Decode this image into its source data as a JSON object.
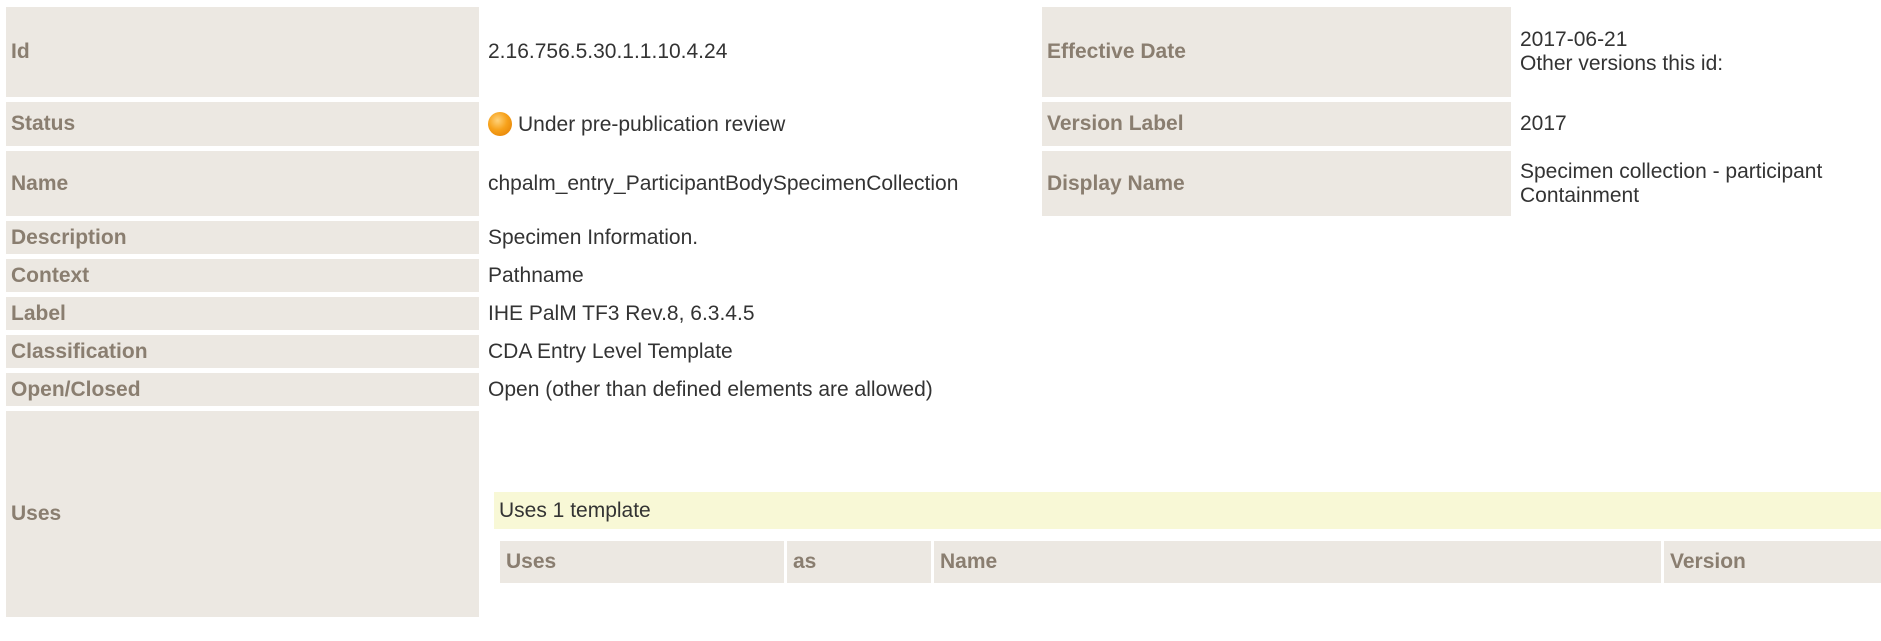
{
  "rows": {
    "id": {
      "label": "Id",
      "value": "2.16.756.5.30.1.1.10.4.24"
    },
    "effective_date": {
      "label": "Effective Date",
      "value": "2017-06-21",
      "other_versions": "Other versions this id:"
    },
    "status": {
      "label": "Status",
      "value": "Under pre-publication review",
      "icon": "status-orange-dot"
    },
    "version_label": {
      "label": "Version Label",
      "value": "2017"
    },
    "name": {
      "label": "Name",
      "value": "chpalm_entry_ParticipantBodySpecimenCollection"
    },
    "display_name": {
      "label": "Display Name",
      "value_line1": "Specimen collection - participant",
      "value_line2": "Containment"
    },
    "description": {
      "label": "Description",
      "value": "Specimen Information."
    },
    "context": {
      "label": "Context",
      "value": "Pathname"
    },
    "label": {
      "label": "Label",
      "value": "IHE PalM TF3 Rev.8, 6.3.4.5"
    },
    "classification": {
      "label": "Classification",
      "value": "CDA Entry Level Template"
    },
    "open_closed": {
      "label": "Open/Closed",
      "value": "Open (other than defined elements are allowed)"
    },
    "uses": {
      "label": "Uses"
    }
  },
  "uses_section": {
    "summary": "Uses 1 template",
    "columns": [
      "Uses",
      "as",
      "Name",
      "Version"
    ]
  },
  "colors": {
    "label_bg": "#ece8e2",
    "label_text": "#8a7e70",
    "uses_box_bg": "#f8f8d6",
    "status_dot": "#f7a21b"
  }
}
